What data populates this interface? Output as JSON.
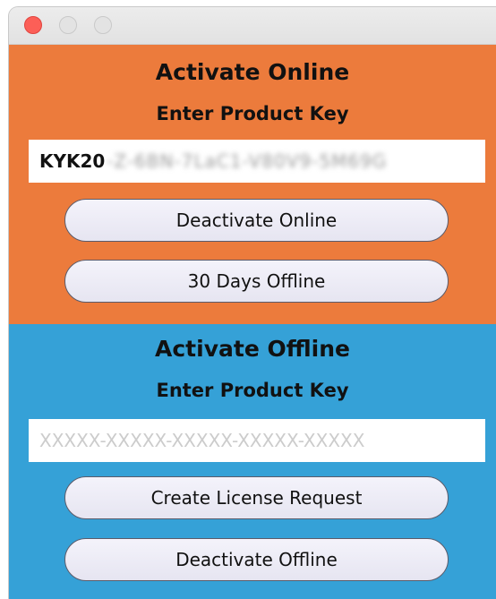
{
  "window": {
    "controls": [
      "close-button",
      "minimize-button",
      "zoom-button"
    ]
  },
  "online": {
    "title": "Activate Online",
    "subtitle": "Enter Product Key",
    "key_prefix": "KYK20",
    "key_masked": "-Z-6BN-7LaC1-V80V9-5M69G",
    "deactivate_label": "Deactivate Online",
    "offline_days_label": "30 Days Offline"
  },
  "offline": {
    "title": "Activate Offline",
    "subtitle": "Enter Product Key",
    "key_placeholder": "XXXXX-XXXXX-XXXXX-XXXXX-XXXXX",
    "create_request_label": "Create License Request",
    "deactivate_label": "Deactivate Offline"
  },
  "colors": {
    "online_bg": "#ec7b3c",
    "offline_bg": "#35a1d7",
    "close_red": "#fc5f57"
  }
}
